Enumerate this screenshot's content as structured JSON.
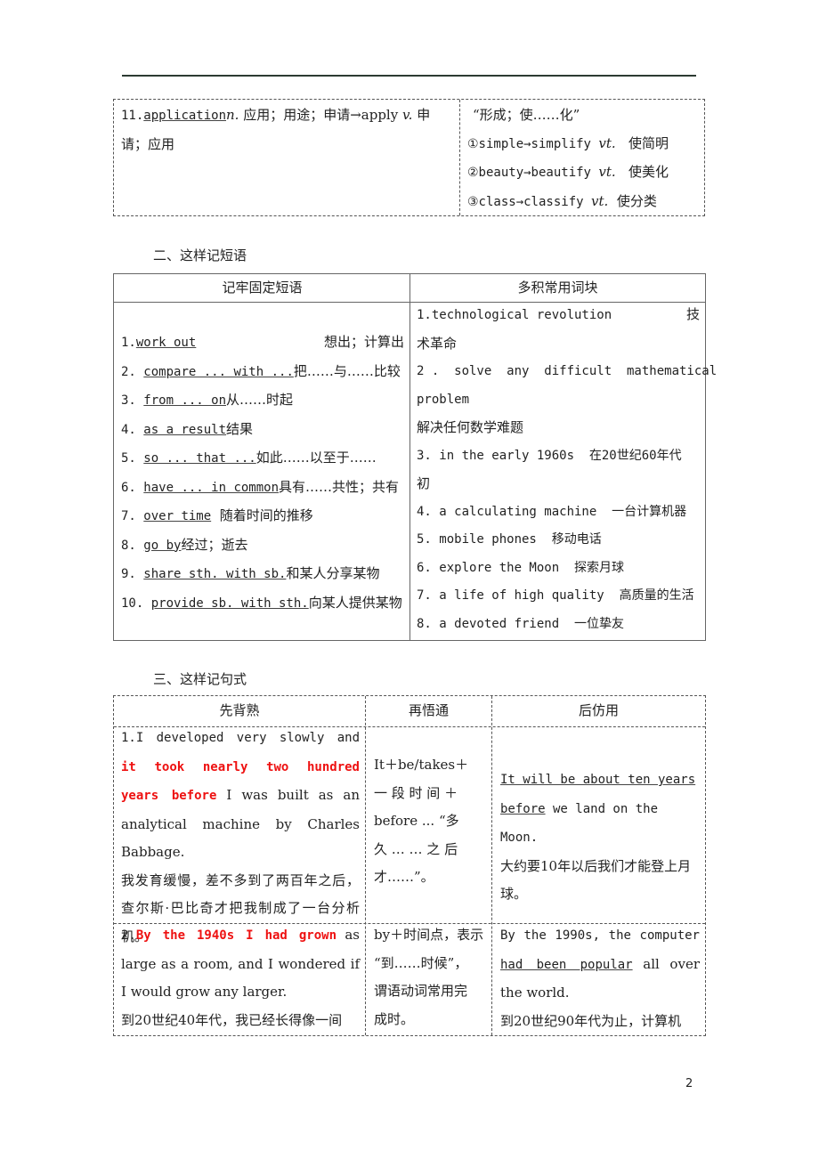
{
  "box1": {
    "left": {
      "num": "11.",
      "word": "application",
      "pos": "n.",
      "rest": " 应用；用途；申请→apply ",
      "pos2": "v.",
      "rest2": " 申",
      "line2": "请；应用"
    },
    "right": {
      "title": "“形成；使……化”",
      "items": [
        {
          "text": "①simple→simplify ",
          "pos": "vt.",
          "meaning": "使简明"
        },
        {
          "text": "②beauty→beautify ",
          "pos": "vt.",
          "meaning": "使美化"
        },
        {
          "text": "③class→classify ",
          "pos": "vt.",
          "meaning": "使分类"
        }
      ]
    }
  },
  "section2": {
    "title": "二、这样记短语",
    "headers": [
      "记牢固定短语",
      "多积常用词块"
    ],
    "fixed_phrases": [
      {
        "num": "1.",
        "phrase": "work out",
        "meaning": "想出；计算出"
      },
      {
        "num": "2. ",
        "phrase": "compare ... with ...",
        "meaning": "把……与……比较"
      },
      {
        "num": "3. ",
        "phrase": "from ... on",
        "meaning": "从……时起"
      },
      {
        "num": "4. ",
        "phrase": "as a result",
        "meaning": "结果"
      },
      {
        "num": "5. ",
        "phrase": "so ... that ...",
        "meaning": "如此……以至于……"
      },
      {
        "num": "6. ",
        "phrase": "have ... in common",
        "meaning": "具有……共性；共有"
      },
      {
        "num": "7. ",
        "phrase": "over time",
        "meaning": "  随着时间的推移"
      },
      {
        "num": "8. ",
        "phrase": "go by",
        "meaning": "经过；逝去"
      },
      {
        "num": "9. ",
        "phrase": "share sth. with sb.",
        "meaning": "和某人分享某物"
      },
      {
        "num": "10. ",
        "phrase": "provide sb. with sth.",
        "meaning": "向某人提供某物"
      }
    ],
    "word_chunks": [
      "1.technological revolution",
      "技",
      "术革命",
      "2 .  solve  any  difficult  mathematical",
      "problem",
      "解决任何数学难题",
      "3. in the early 1960s  在20世纪60年代",
      "初",
      "4. a calculating machine  一台计算机器",
      "5. mobile phones  移动电话",
      "6. explore the Moon  探索月球",
      "7. a life of high quality  高质量的生活",
      "8. a devoted friend  一位挚友"
    ]
  },
  "section3": {
    "title": "三、这样记句式",
    "headers": [
      "先背熟",
      "再悟通",
      "后仿用"
    ],
    "rows": [
      {
        "recite_pre": "1.I developed very slowly and ",
        "recite_red": "it took nearly two hundred years before",
        "recite_post": " I was built as an analytical machine by Charles Babbage.",
        "recite_cn": "我发育缓慢，差不多到了两百年之后，查尔斯·巴比奇才把我制成了一台分析机。",
        "understand": [
          "It＋be/takes＋",
          "一 段 时 间 ＋",
          "before ... “多",
          "久 … … 之 后",
          "才……”。"
        ],
        "imitate_u": "It will be about ten years before",
        "imitate_post": " we land on the Moon.",
        "imitate_cn": "大约要10年以后我们才能登上月球。"
      },
      {
        "recite_pre": "2.",
        "recite_red": "By the 1940s I had grown",
        "recite_post": " as large as a room, and I wondered if I would grow any larger.",
        "recite_cn": "到20世纪40年代，我已经长得像一间",
        "understand": [
          "by＋时间点，表示",
          "“到……时候”，",
          "谓语动词常用完",
          "成时。"
        ],
        "imitate_pre": "By the 1990s, the computer ",
        "imitate_u": "had been popular",
        "imitate_post": " all over the world.",
        "imitate_cn": "到20世纪90年代为止，计算机"
      }
    ]
  },
  "page_number": "2"
}
